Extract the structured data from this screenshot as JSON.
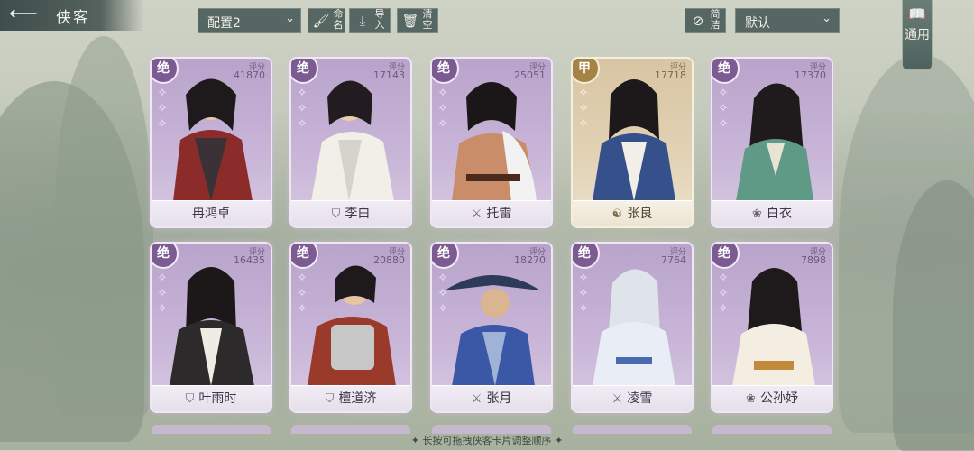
{
  "header": {
    "title": "侠客",
    "back_icon": "back-arrow-icon",
    "preset": "配置2",
    "rename_label": "命名",
    "import_label": "导入",
    "clear_label": "清空",
    "simple_label": "简洁",
    "sort": "默认",
    "general_label": "通用"
  },
  "score_label": "评分",
  "cards": [
    {
      "name": "冉鸿卓",
      "rank": "绝",
      "score": "41870",
      "sect": "",
      "tier": "purple"
    },
    {
      "name": "李白",
      "rank": "绝",
      "score": "17143",
      "sect": "shield-icon",
      "tier": "purple"
    },
    {
      "name": "托雷",
      "rank": "绝",
      "score": "25051",
      "sect": "sword-icon",
      "tier": "purple"
    },
    {
      "name": "张良",
      "rank": "甲",
      "score": "17718",
      "sect": "taiji-icon",
      "tier": "gold"
    },
    {
      "name": "白衣",
      "rank": "绝",
      "score": "17370",
      "sect": "lotus-icon",
      "tier": "purple"
    },
    {
      "name": "叶雨时",
      "rank": "绝",
      "score": "16435",
      "sect": "shield-icon",
      "tier": "purple"
    },
    {
      "name": "檀道济",
      "rank": "绝",
      "score": "20880",
      "sect": "shield-icon",
      "tier": "purple"
    },
    {
      "name": "张月",
      "rank": "绝",
      "score": "18270",
      "sect": "sword-icon",
      "tier": "purple"
    },
    {
      "name": "凌雪",
      "rank": "绝",
      "score": "7764",
      "sect": "sword-icon",
      "tier": "purple"
    },
    {
      "name": "公孙妤",
      "rank": "绝",
      "score": "7898",
      "sect": "lotus-icon",
      "tier": "purple"
    }
  ],
  "hint": "✦ 长按可拖拽侠客卡片调整顺序 ✦"
}
